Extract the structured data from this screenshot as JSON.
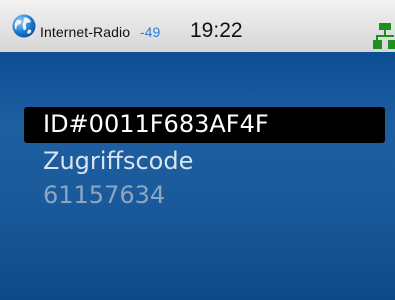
{
  "status_bar": {
    "app_name": "Internet-Radio",
    "signal_strength": "-49",
    "time": "19:22",
    "left_icon": "globe-icon",
    "right_icon": "network-icon"
  },
  "menu": {
    "items": [
      {
        "label": "ID#0011F683AF4F",
        "selected": true
      },
      {
        "label": "Zugriffscode"
      },
      {
        "label": "61157634"
      }
    ]
  },
  "colors": {
    "status_bar_bg": "#e0e0e0",
    "content_bg": "#1a5a9a",
    "selection_bg": "#000000",
    "signal_color": "#2e7ed8",
    "network_icon_color": "#1f8f1f"
  }
}
